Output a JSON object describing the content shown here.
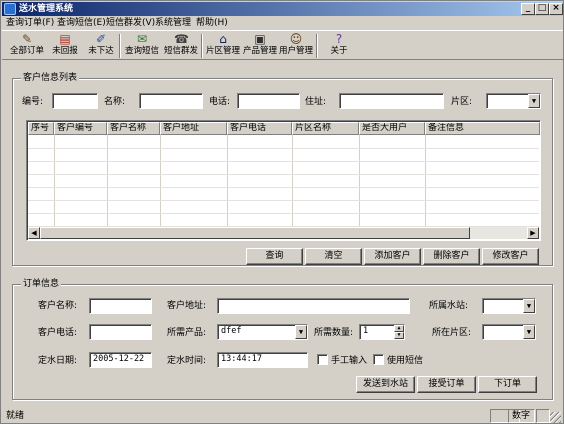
{
  "window": {
    "title": "送水管理系统",
    "controls": {
      "minimize": "_",
      "maximize": "□",
      "close": "×"
    }
  },
  "menu": [
    "查询订单(F)",
    "查询短信(E)",
    "短信群发(V)",
    "系统管理",
    "帮助(H)"
  ],
  "toolbar": [
    {
      "label": "全部订单",
      "icon": "pencil-icon",
      "glyph": "✎"
    },
    {
      "label": "未回报",
      "icon": "document-icon",
      "glyph": "▤"
    },
    {
      "label": "未下达",
      "icon": "notebook-icon",
      "glyph": "✐"
    },
    {
      "label": "查询短信",
      "icon": "envelope-icon",
      "glyph": "✉"
    },
    {
      "label": "短信群发",
      "icon": "mobile-icon",
      "glyph": "☎"
    },
    {
      "label": "片区管理",
      "icon": "house-icon",
      "glyph": "⌂"
    },
    {
      "label": "产品管理",
      "icon": "product-icon",
      "glyph": "▣"
    },
    {
      "label": "用户管理",
      "icon": "users-icon",
      "glyph": "☺"
    },
    {
      "label": "关于",
      "icon": "help-icon",
      "glyph": "?"
    }
  ],
  "customer_section": {
    "title": "客户信息列表",
    "filters": {
      "id_label": "编号:",
      "name_label": "名称:",
      "phone_label": "电话:",
      "address_label": "住址:",
      "area_label": "片区:",
      "id_value": "",
      "name_value": "",
      "phone_value": "",
      "address_value": "",
      "area_value": ""
    },
    "columns": [
      "序号",
      "客户编号",
      "客户名称",
      "客户地址",
      "客户电话",
      "片区名称",
      "是否大用户",
      "备注信息"
    ],
    "rows": [],
    "buttons": {
      "query": "查询",
      "clear": "清空",
      "add": "添加客户",
      "delete": "删除客户",
      "edit": "修改客户"
    }
  },
  "order_section": {
    "title": "订单信息",
    "labels": {
      "customer_name": "客户名称:",
      "customer_address": "客户地址:",
      "station": "所属水站:",
      "customer_phone": "客户电话:",
      "product": "所需产品:",
      "quantity": "所需数量:",
      "area": "所在片区:",
      "date": "定水日期:",
      "time": "定水时间:",
      "manual_input": "手工输入",
      "use_sms": "使用短信"
    },
    "values": {
      "customer_name": "",
      "customer_address": "",
      "station": "",
      "customer_phone": "",
      "product": "dfef",
      "quantity": "1",
      "area": "",
      "date": "2005-12-22",
      "time": "13:44:17",
      "manual_input_checked": false,
      "use_sms_checked": false
    },
    "buttons": {
      "send": "发送到水站",
      "accept": "接受订单",
      "place": "下订单"
    }
  },
  "statusbar": {
    "text": "就绪",
    "pane_numlock": "数字"
  }
}
